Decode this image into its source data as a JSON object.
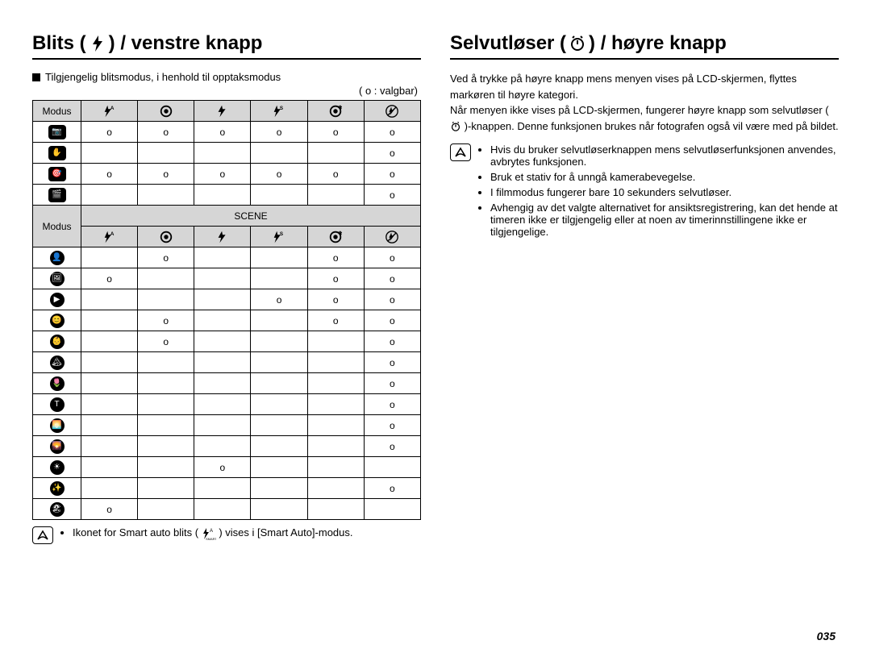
{
  "left": {
    "title_pre": "Blits (",
    "title_post": ") / venstre knapp",
    "subhead": "Tilgjengelig blitsmodus, i henhold til opptaksmodus",
    "legend": "( o : valgbar)",
    "modus_label": "Modus",
    "scene_label": "SCENE",
    "col_icons": [
      "flash-auto-icon",
      "redeye-icon",
      "flash-fill-icon",
      "flash-slow-icon",
      "redeye-fix-icon",
      "flash-off-icon"
    ],
    "top_rows": [
      {
        "icon": "camera-p-icon",
        "cells": [
          "o",
          "o",
          "o",
          "o",
          "o",
          "o"
        ]
      },
      {
        "icon": "steady-icon",
        "cells": [
          "",
          "",
          "",
          "",
          "",
          "o"
        ]
      },
      {
        "icon": "smart-cam-icon",
        "cells": [
          "o",
          "o",
          "o",
          "o",
          "o",
          "o"
        ]
      },
      {
        "icon": "movie-icon",
        "cells": [
          "",
          "",
          "",
          "",
          "",
          "o"
        ]
      }
    ],
    "scene_rows": [
      {
        "icon": "scene-beauty-icon",
        "cells": [
          "",
          "o",
          "",
          "",
          "o",
          "o"
        ]
      },
      {
        "icon": "scene-frame-icon",
        "cells": [
          "o",
          "",
          "",
          "",
          "o",
          "o"
        ]
      },
      {
        "icon": "scene-night-icon",
        "cells": [
          "",
          "",
          "",
          "o",
          "o",
          "o"
        ]
      },
      {
        "icon": "scene-portrait-icon",
        "cells": [
          "",
          "o",
          "",
          "",
          "o",
          "o"
        ]
      },
      {
        "icon": "scene-children-icon",
        "cells": [
          "",
          "o",
          "",
          "",
          "",
          "o"
        ]
      },
      {
        "icon": "scene-landscape-icon",
        "cells": [
          "",
          "",
          "",
          "",
          "",
          "o"
        ]
      },
      {
        "icon": "scene-closeup-icon",
        "cells": [
          "",
          "",
          "",
          "",
          "",
          "o"
        ]
      },
      {
        "icon": "scene-text-icon",
        "cells": [
          "",
          "",
          "",
          "",
          "",
          "o"
        ]
      },
      {
        "icon": "scene-sunset-icon",
        "cells": [
          "",
          "",
          "",
          "",
          "",
          "o"
        ]
      },
      {
        "icon": "scene-dawn-icon",
        "cells": [
          "",
          "",
          "",
          "",
          "",
          "o"
        ]
      },
      {
        "icon": "scene-backlight-icon",
        "cells": [
          "",
          "",
          "o",
          "",
          "",
          ""
        ]
      },
      {
        "icon": "scene-firework-icon",
        "cells": [
          "",
          "",
          "",
          "",
          "",
          "o"
        ]
      },
      {
        "icon": "scene-beach-icon",
        "cells": [
          "o",
          "",
          "",
          "",
          "",
          ""
        ]
      }
    ],
    "note_pre": "Ikonet for Smart auto blits (",
    "note_post": ") vises i [Smart Auto]-modus."
  },
  "right": {
    "title_pre": "Selvutløser (",
    "title_post": ") / høyre knapp",
    "para": "Ved å trykke på høyre knapp mens menyen vises på LCD-skjermen, flyttes markøren til høyre kategori.\nNår menyen ikke vises på LCD-skjermen, fungerer høyre knapp som selvutløser ( ",
    "para2": " )-knappen. Denne funksjonen brukes når fotografen også vil være med på bildet.",
    "bullets": [
      "Hvis du bruker selvutløserknappen mens selvutløserfunksjonen anvendes, avbrytes funksjonen.",
      "Bruk et stativ for å unngå kamerabevegelse.",
      "I filmmodus fungerer bare 10 sekunders selvutløser.",
      "Avhengig av det valgte alternativet for ansiktsregistrering, kan det hende at timeren ikke er tilgjengelig eller at noen av timerinnstillingene ikke er tilgjengelige."
    ]
  },
  "pagenum": "035"
}
